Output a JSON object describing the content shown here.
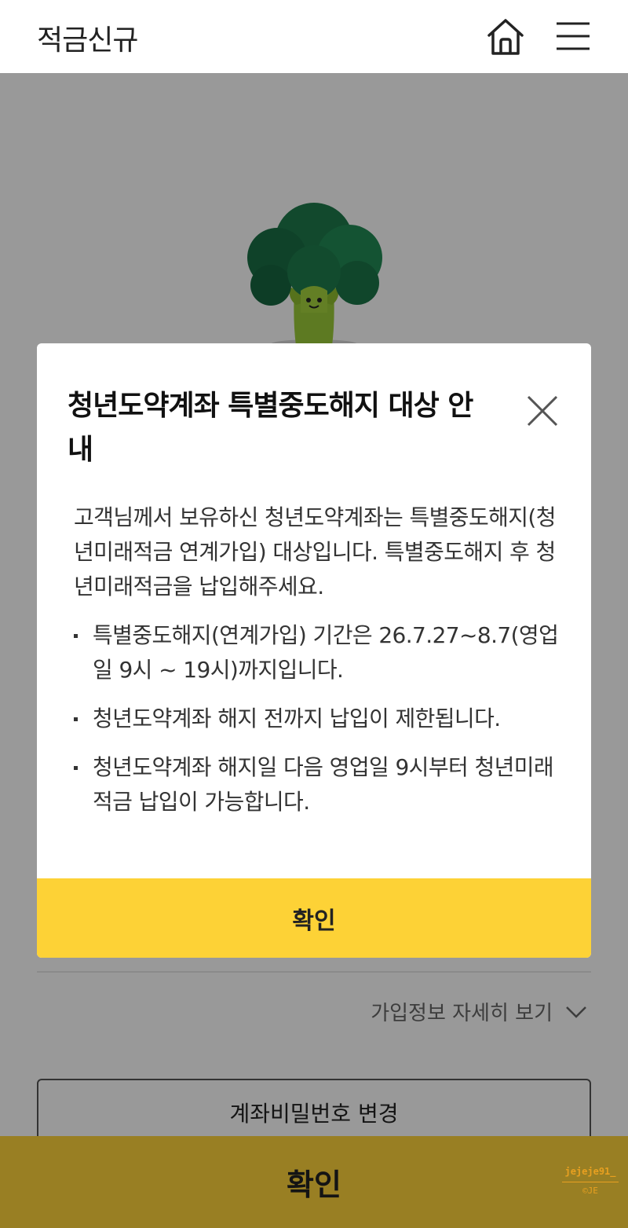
{
  "header": {
    "title": "적금신규",
    "home_icon": "home-icon",
    "menu_icon": "hamburger-menu-icon"
  },
  "page": {
    "mascot": "broccoli-character",
    "details_link": "가입정보 자세히 보기",
    "password_change_button": "계좌비밀번호 변경",
    "bottom_confirm": "확인"
  },
  "modal": {
    "title": "청년도약계좌 특별중도해지 대상 안내",
    "intro": "고객님께서 보유하신 청년도약계좌는 특별중도해지(청년미래적금 연계가입) 대상입니다. 특별중도해지 후 청년미래적금을 납입해주세요.",
    "bullets": [
      "특별중도해지(연계가입) 기간은 26.7.27~8.7(영업일 9시 ~ 19시)까지입니다.",
      "청년도약계좌 해지 전까지 납입이 제한됩니다.",
      "청년도약계좌 해지일 다음 영업일 9시부터 청년미래적금 납입이 가능합니다."
    ],
    "confirm": "확인"
  },
  "watermark": {
    "name": "jejeje91_",
    "copyright": "©JE"
  },
  "colors": {
    "accent_yellow": "#fdd236",
    "dim_overlay": "rgba(0,0,0,0.40)",
    "broccoli_green": "#1f7a4d"
  }
}
